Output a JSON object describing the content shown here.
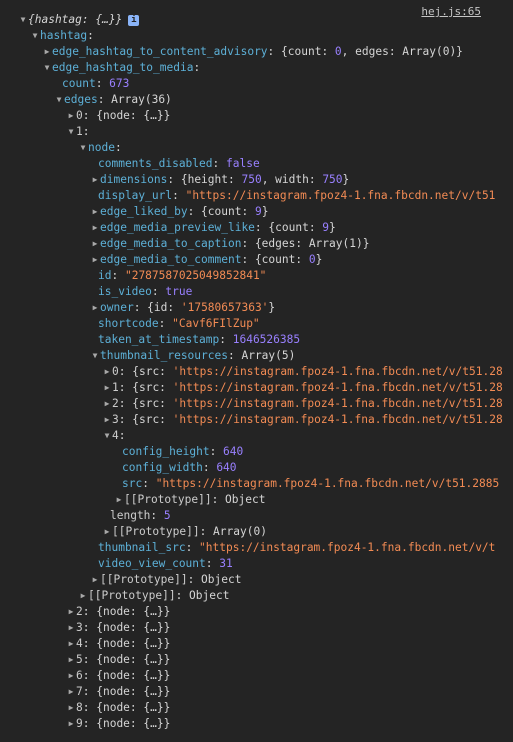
{
  "source_link": "hej.js:65",
  "info_icon": "i",
  "rows": [
    {
      "indent": 18,
      "tw": "down",
      "k": "",
      "kc": "",
      "parts": [
        {
          "t": "{hashtag: {…}}",
          "c": "plain italic"
        }
      ],
      "info": true
    },
    {
      "indent": 30,
      "tw": "down",
      "k": "hashtag",
      "kc": "key",
      "parts": []
    },
    {
      "indent": 42,
      "tw": "right",
      "k": "edge_hashtag_to_content_advisory",
      "kc": "key",
      "parts": [
        {
          "t": "{count: ",
          "c": "plain"
        },
        {
          "t": "0",
          "c": "num"
        },
        {
          "t": ", edges: Array(0)}",
          "c": "plain"
        }
      ]
    },
    {
      "indent": 42,
      "tw": "down",
      "k": "edge_hashtag_to_media",
      "kc": "key",
      "parts": []
    },
    {
      "indent": 62,
      "tw": "",
      "k": "count",
      "kc": "key",
      "parts": [
        {
          "t": "673",
          "c": "num"
        }
      ]
    },
    {
      "indent": 54,
      "tw": "down",
      "k": "edges",
      "kc": "key",
      "parts": [
        {
          "t": "Array(36)",
          "c": "plain"
        }
      ]
    },
    {
      "indent": 66,
      "tw": "right",
      "k": "0",
      "kc": "okey",
      "parts": [
        {
          "t": "{node: {…}}",
          "c": "plain"
        }
      ]
    },
    {
      "indent": 66,
      "tw": "down",
      "k": "1",
      "kc": "okey",
      "parts": []
    },
    {
      "indent": 78,
      "tw": "down",
      "k": "node",
      "kc": "key",
      "parts": []
    },
    {
      "indent": 98,
      "tw": "",
      "k": "comments_disabled",
      "kc": "key",
      "parts": [
        {
          "t": "false",
          "c": "bool"
        }
      ]
    },
    {
      "indent": 90,
      "tw": "right",
      "k": "dimensions",
      "kc": "key",
      "parts": [
        {
          "t": "{height: ",
          "c": "plain"
        },
        {
          "t": "750",
          "c": "num"
        },
        {
          "t": ", width: ",
          "c": "plain"
        },
        {
          "t": "750",
          "c": "num"
        },
        {
          "t": "}",
          "c": "plain"
        }
      ]
    },
    {
      "indent": 98,
      "tw": "",
      "k": "display_url",
      "kc": "key",
      "parts": [
        {
          "t": "\"https://instagram.fpoz4-1.fna.fbcdn.net/v/t51",
          "c": "str"
        }
      ]
    },
    {
      "indent": 90,
      "tw": "right",
      "k": "edge_liked_by",
      "kc": "key",
      "parts": [
        {
          "t": "{count: ",
          "c": "plain"
        },
        {
          "t": "9",
          "c": "num"
        },
        {
          "t": "}",
          "c": "plain"
        }
      ]
    },
    {
      "indent": 90,
      "tw": "right",
      "k": "edge_media_preview_like",
      "kc": "key",
      "parts": [
        {
          "t": "{count: ",
          "c": "plain"
        },
        {
          "t": "9",
          "c": "num"
        },
        {
          "t": "}",
          "c": "plain"
        }
      ]
    },
    {
      "indent": 90,
      "tw": "right",
      "k": "edge_media_to_caption",
      "kc": "key",
      "parts": [
        {
          "t": "{edges: Array(1)}",
          "c": "plain"
        }
      ]
    },
    {
      "indent": 90,
      "tw": "right",
      "k": "edge_media_to_comment",
      "kc": "key",
      "parts": [
        {
          "t": "{count: ",
          "c": "plain"
        },
        {
          "t": "0",
          "c": "num"
        },
        {
          "t": "}",
          "c": "plain"
        }
      ]
    },
    {
      "indent": 98,
      "tw": "",
      "k": "id",
      "kc": "key",
      "parts": [
        {
          "t": "\"2787587025049852841\"",
          "c": "str"
        }
      ]
    },
    {
      "indent": 98,
      "tw": "",
      "k": "is_video",
      "kc": "key",
      "parts": [
        {
          "t": "true",
          "c": "bool"
        }
      ]
    },
    {
      "indent": 90,
      "tw": "right",
      "k": "owner",
      "kc": "key",
      "parts": [
        {
          "t": "{id: ",
          "c": "plain"
        },
        {
          "t": "'17580657363'",
          "c": "str"
        },
        {
          "t": "}",
          "c": "plain"
        }
      ]
    },
    {
      "indent": 98,
      "tw": "",
      "k": "shortcode",
      "kc": "key",
      "parts": [
        {
          "t": "\"Cavf6FIlZup\"",
          "c": "str"
        }
      ]
    },
    {
      "indent": 98,
      "tw": "",
      "k": "taken_at_timestamp",
      "kc": "key",
      "parts": [
        {
          "t": "1646526385",
          "c": "num"
        }
      ]
    },
    {
      "indent": 90,
      "tw": "down",
      "k": "thumbnail_resources",
      "kc": "key",
      "parts": [
        {
          "t": "Array(5)",
          "c": "plain"
        }
      ]
    },
    {
      "indent": 102,
      "tw": "right",
      "k": "0",
      "kc": "okey",
      "parts": [
        {
          "t": "{src: ",
          "c": "plain"
        },
        {
          "t": "'https://instagram.fpoz4-1.fna.fbcdn.net/v/t51.28",
          "c": "str"
        }
      ]
    },
    {
      "indent": 102,
      "tw": "right",
      "k": "1",
      "kc": "okey",
      "parts": [
        {
          "t": "{src: ",
          "c": "plain"
        },
        {
          "t": "'https://instagram.fpoz4-1.fna.fbcdn.net/v/t51.28",
          "c": "str"
        }
      ]
    },
    {
      "indent": 102,
      "tw": "right",
      "k": "2",
      "kc": "okey",
      "parts": [
        {
          "t": "{src: ",
          "c": "plain"
        },
        {
          "t": "'https://instagram.fpoz4-1.fna.fbcdn.net/v/t51.28",
          "c": "str"
        }
      ]
    },
    {
      "indent": 102,
      "tw": "right",
      "k": "3",
      "kc": "okey",
      "parts": [
        {
          "t": "{src: ",
          "c": "plain"
        },
        {
          "t": "'https://instagram.fpoz4-1.fna.fbcdn.net/v/t51.28",
          "c": "str"
        }
      ]
    },
    {
      "indent": 102,
      "tw": "down",
      "k": "4",
      "kc": "okey",
      "parts": []
    },
    {
      "indent": 122,
      "tw": "",
      "k": "config_height",
      "kc": "key",
      "parts": [
        {
          "t": "640",
          "c": "num"
        }
      ]
    },
    {
      "indent": 122,
      "tw": "",
      "k": "config_width",
      "kc": "key",
      "parts": [
        {
          "t": "640",
          "c": "num"
        }
      ]
    },
    {
      "indent": 122,
      "tw": "",
      "k": "src",
      "kc": "key",
      "parts": [
        {
          "t": "\"https://instagram.fpoz4-1.fna.fbcdn.net/v/t51.2885",
          "c": "str"
        }
      ]
    },
    {
      "indent": 114,
      "tw": "right",
      "k": "[[Prototype]]",
      "kc": "okey",
      "parts": [
        {
          "t": "Object",
          "c": "plain"
        }
      ]
    },
    {
      "indent": 110,
      "tw": "",
      "k": "length",
      "kc": "okey",
      "parts": [
        {
          "t": "5",
          "c": "num"
        }
      ]
    },
    {
      "indent": 102,
      "tw": "right",
      "k": "[[Prototype]]",
      "kc": "okey",
      "parts": [
        {
          "t": "Array(0)",
          "c": "plain"
        }
      ]
    },
    {
      "indent": 98,
      "tw": "",
      "k": "thumbnail_src",
      "kc": "key",
      "parts": [
        {
          "t": "\"https://instagram.fpoz4-1.fna.fbcdn.net/v/t",
          "c": "str"
        }
      ]
    },
    {
      "indent": 98,
      "tw": "",
      "k": "video_view_count",
      "kc": "key",
      "parts": [
        {
          "t": "31",
          "c": "num"
        }
      ]
    },
    {
      "indent": 90,
      "tw": "right",
      "k": "[[Prototype]]",
      "kc": "okey",
      "parts": [
        {
          "t": "Object",
          "c": "plain"
        }
      ]
    },
    {
      "indent": 78,
      "tw": "right",
      "k": "[[Prototype]]",
      "kc": "okey",
      "parts": [
        {
          "t": "Object",
          "c": "plain"
        }
      ]
    },
    {
      "indent": 66,
      "tw": "right",
      "k": "2",
      "kc": "okey",
      "parts": [
        {
          "t": "{node: {…}}",
          "c": "plain"
        }
      ]
    },
    {
      "indent": 66,
      "tw": "right",
      "k": "3",
      "kc": "okey",
      "parts": [
        {
          "t": "{node: {…}}",
          "c": "plain"
        }
      ]
    },
    {
      "indent": 66,
      "tw": "right",
      "k": "4",
      "kc": "okey",
      "parts": [
        {
          "t": "{node: {…}}",
          "c": "plain"
        }
      ]
    },
    {
      "indent": 66,
      "tw": "right",
      "k": "5",
      "kc": "okey",
      "parts": [
        {
          "t": "{node: {…}}",
          "c": "plain"
        }
      ]
    },
    {
      "indent": 66,
      "tw": "right",
      "k": "6",
      "kc": "okey",
      "parts": [
        {
          "t": "{node: {…}}",
          "c": "plain"
        }
      ]
    },
    {
      "indent": 66,
      "tw": "right",
      "k": "7",
      "kc": "okey",
      "parts": [
        {
          "t": "{node: {…}}",
          "c": "plain"
        }
      ]
    },
    {
      "indent": 66,
      "tw": "right",
      "k": "8",
      "kc": "okey",
      "parts": [
        {
          "t": "{node: {…}}",
          "c": "plain"
        }
      ]
    },
    {
      "indent": 66,
      "tw": "right",
      "k": "9",
      "kc": "okey",
      "parts": [
        {
          "t": "{node: {…}}",
          "c": "plain"
        }
      ]
    }
  ]
}
